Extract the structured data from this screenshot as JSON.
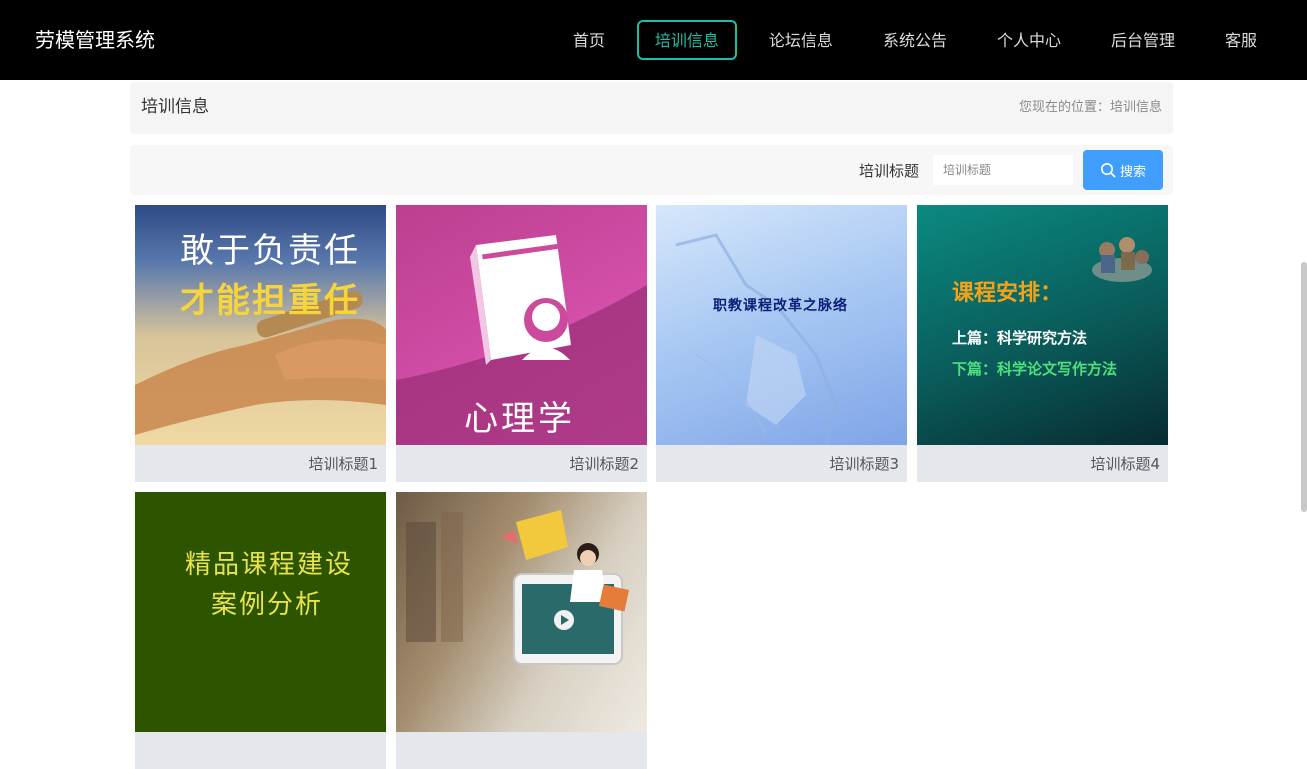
{
  "header": {
    "brand": "劳模管理系统",
    "nav": [
      {
        "label": "首页",
        "active": false
      },
      {
        "label": "培训信息",
        "active": true
      },
      {
        "label": "论坛信息",
        "active": false
      },
      {
        "label": "系统公告",
        "active": false
      },
      {
        "label": "个人中心",
        "active": false
      },
      {
        "label": "后台管理",
        "active": false
      },
      {
        "label": "客服",
        "active": false
      }
    ],
    "accent_color": "#1ebea5"
  },
  "breadcrumb": {
    "title": "培训信息",
    "prefix": "您现在的位置：",
    "current": "培训信息"
  },
  "search": {
    "label": "培训标题",
    "placeholder": "培训标题",
    "value": "",
    "button_label": "搜索",
    "button_icon": "search-icon",
    "button_color": "#409eff"
  },
  "cards": [
    {
      "title": "培训标题1",
      "image_text": [
        "敢于负责任",
        "才能担重任"
      ]
    },
    {
      "title": "培训标题2",
      "image_text": [
        "心理学"
      ]
    },
    {
      "title": "培训标题3",
      "image_text": [
        "职教课程改革之脉络"
      ]
    },
    {
      "title": "培训标题4",
      "image_text": [
        "课程安排：",
        "上篇：科学研究方法",
        "下篇：科学论文写作方法"
      ]
    },
    {
      "title": "",
      "image_text": [
        "精品课程建设",
        "案例分析"
      ]
    },
    {
      "title": "",
      "image_text": []
    }
  ]
}
